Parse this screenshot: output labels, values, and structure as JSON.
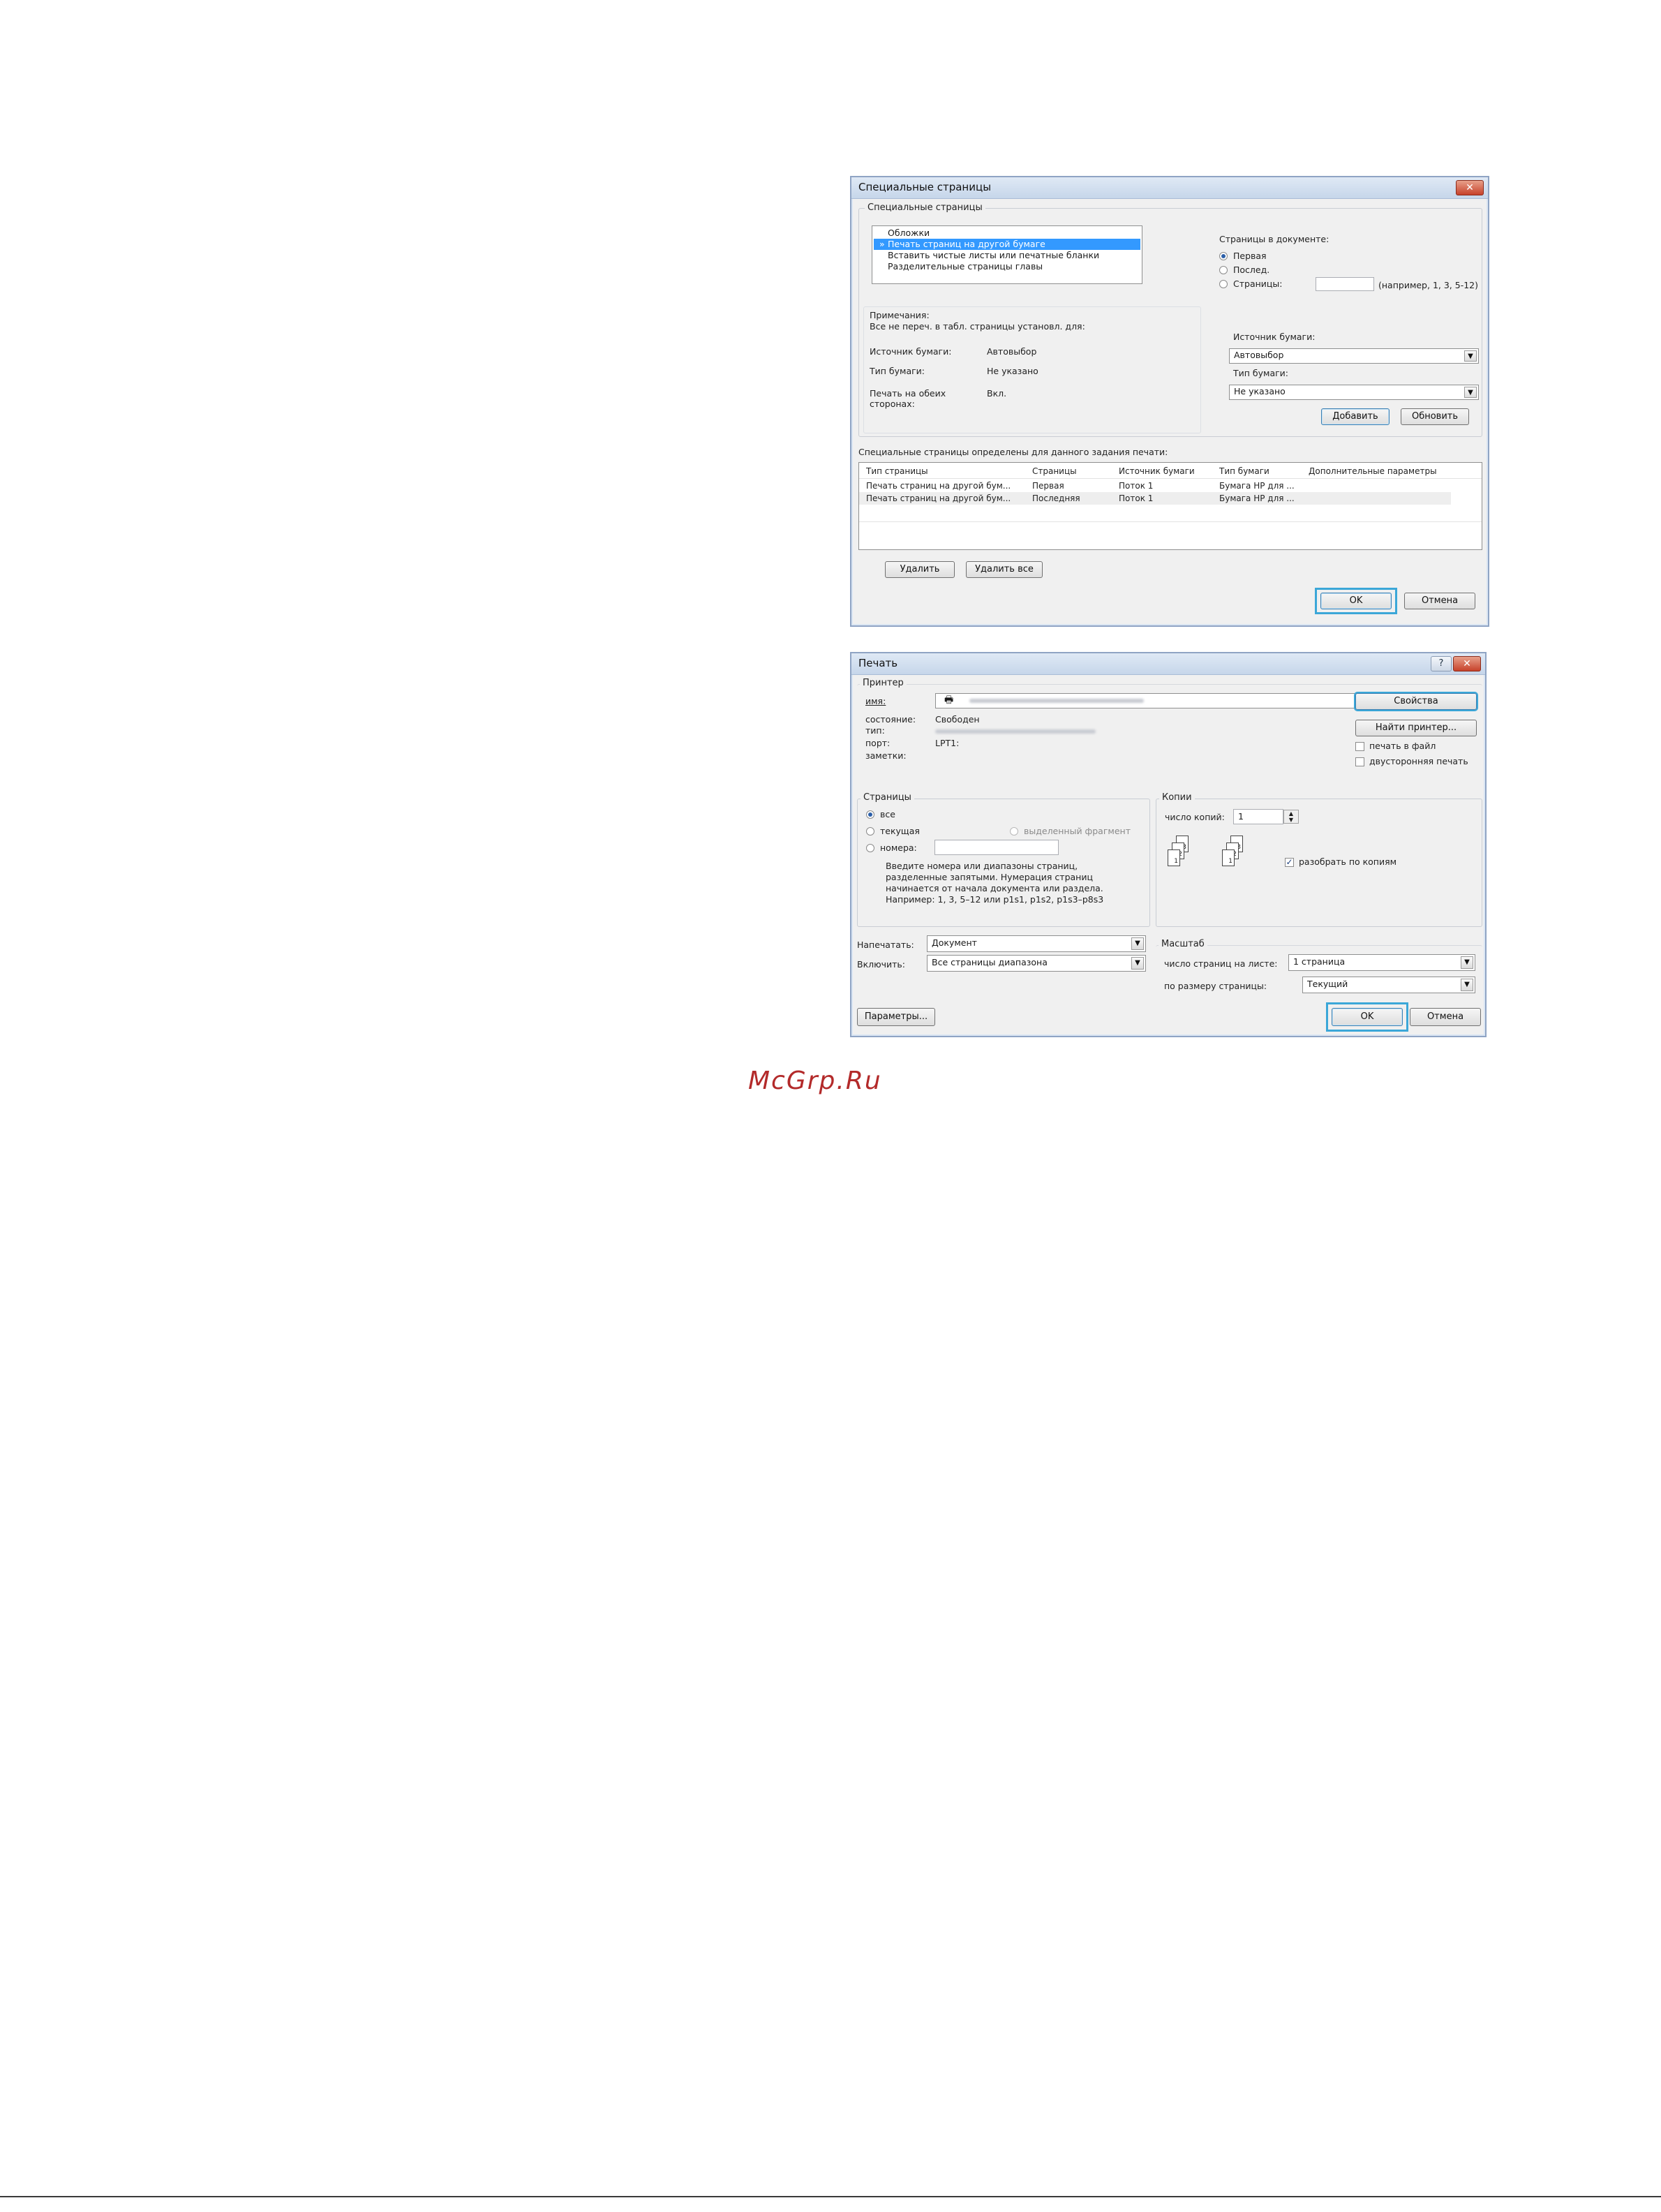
{
  "special_pages": {
    "title": "Специальные страницы",
    "group_label": "Специальные страницы",
    "list_items": [
      {
        "label": "Обложки",
        "marker": ""
      },
      {
        "label": "Печать страниц на другой бумаге",
        "marker": "»"
      },
      {
        "label": "Вставить чистые листы или печатные бланки",
        "marker": ""
      },
      {
        "label": "Разделительные страницы главы",
        "marker": ""
      }
    ],
    "pages_in_doc_label": "Страницы в документе:",
    "radio_first": "Первая",
    "radio_last": "Послед.",
    "radio_pages": "Страницы:",
    "pages_example": "(например, 1, 3, 5-12)",
    "notes_label": "Примечания:",
    "notes_text": "Все не переч. в табл. страницы установл. для:",
    "info_source_label": "Источник бумаги:",
    "info_source_value": "Автовыбор",
    "info_type_label": "Тип бумаги:",
    "info_type_value": "Не указано",
    "info_duplex_label": "Печать на обеих сторонах:",
    "info_duplex_value": "Вкл.",
    "source_label": "Источник бумаги:",
    "source_value": "Автовыбор",
    "type_label": "Тип бумаги:",
    "type_value": "Не указано",
    "add_button": "Добавить",
    "update_button": "Обновить",
    "defined_label": "Специальные страницы определены для данного задания печати:",
    "table_headers": [
      "Тип страницы",
      "Страницы",
      "Источник бумаги",
      "Тип бумаги",
      "Дополнительные параметры"
    ],
    "table_rows": [
      [
        "Печать страниц на другой бум...",
        "Первая",
        "Поток 1",
        "Бумага HP для ...",
        ""
      ],
      [
        "Печать страниц на другой бум...",
        "Последняя",
        "Поток 1",
        "Бумага HP для ...",
        ""
      ]
    ],
    "delete_button": "Удалить",
    "delete_all_button": "Удалить все",
    "ok_button": "OK",
    "cancel_button": "Отмена"
  },
  "print": {
    "title": "Печать",
    "help_button": "?",
    "printer_group": "Принтер",
    "name_label": "имя:",
    "status_label": "состояние:",
    "status_value": "Свободен",
    "type_label": "тип:",
    "port_label": "порт:",
    "port_value": "LPT1:",
    "notes_label": "заметки:",
    "properties_button": "Свойства",
    "find_printer_button": "Найти принтер...",
    "print_to_file": "печать в файл",
    "duplex_print": "двусторонняя печать",
    "pages_group": "Страницы",
    "radio_all": "все",
    "radio_current": "текущая",
    "radio_selection": "выделенный фрагмент",
    "radio_numbers": "номера:",
    "pages_hint": [
      "Введите номера или диапазоны страниц,",
      "разделенные запятыми. Нумерация страниц",
      "начинается от начала документа или раздела.",
      "Например: 1, 3, 5–12 или p1s1, p1s2, p1s3–p8s3"
    ],
    "copies_group": "Копии",
    "copies_label": "число копий:",
    "copies_value": "1",
    "collate_label": "разобрать по копиям",
    "print_what_label": "Напечатать:",
    "print_what_value": "Документ",
    "include_label": "Включить:",
    "include_value": "Все страницы диапазона",
    "zoom_group": "Масштаб",
    "pages_per_sheet_label": "число страниц на листе:",
    "pages_per_sheet_value": "1 страница",
    "scale_label": "по размеру страницы:",
    "scale_value": "Текущий",
    "options_button": "Параметры...",
    "ok_button": "OK",
    "cancel_button": "Отмена"
  },
  "watermark": "McGrp.Ru",
  "colors": {
    "selection": "#3399ff",
    "highlight_ring": "#3ba7d8",
    "watermark": "#b32a2a"
  }
}
